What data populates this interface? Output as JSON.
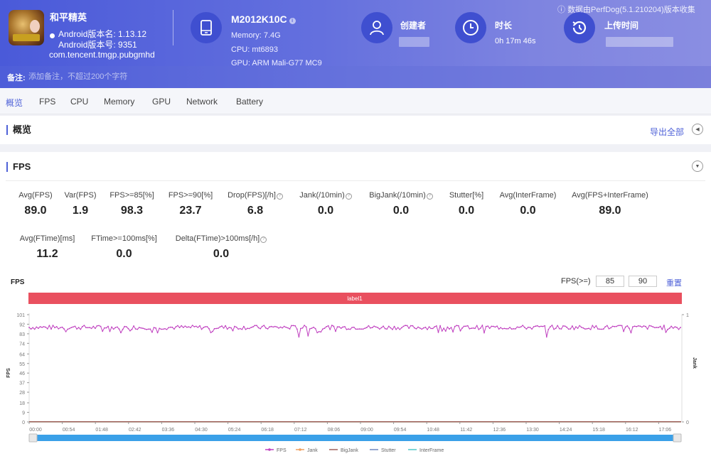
{
  "app": {
    "name": "和平精英",
    "version_name": "Android版本名: 1.13.12",
    "version_code": "Android版本号: 9351",
    "package": "com.tencent.tmgp.pubgmhd"
  },
  "device": {
    "model": "M2012K10C",
    "memory": "Memory: 7.4G",
    "cpu": "CPU: mt6893",
    "gpu": "GPU: ARM Mali-G77 MC9"
  },
  "creator": {
    "label": "创建者",
    "value_redacted": true
  },
  "duration": {
    "label": "时长",
    "value": "0h 17m 46s"
  },
  "upload_time": {
    "label": "上传时间",
    "value_redacted": true
  },
  "source_note": "数据由PerfDog(5.1.210204)版本收集",
  "remark": {
    "label": "备注:",
    "placeholder": "添加备注，不超过200个字符"
  },
  "tabs": [
    {
      "label": "概览",
      "active": true
    },
    {
      "label": "FPS",
      "active": false
    },
    {
      "label": "CPU",
      "active": false
    },
    {
      "label": "Memory",
      "active": false
    },
    {
      "label": "GPU",
      "active": false
    },
    {
      "label": "Network",
      "active": false
    },
    {
      "label": "Battery",
      "active": false
    }
  ],
  "overview": {
    "title": "概览",
    "export_label": "导出全部"
  },
  "fps_section": {
    "title": "FPS",
    "metrics_row1": [
      {
        "label": "Avg(FPS)",
        "value": "89.0",
        "help": false
      },
      {
        "label": "Var(FPS)",
        "value": "1.9",
        "help": false
      },
      {
        "label": "FPS>=85[%]",
        "value": "98.3",
        "help": false
      },
      {
        "label": "FPS>=90[%]",
        "value": "23.7",
        "help": false
      },
      {
        "label": "Drop(FPS)[/h]",
        "value": "6.8",
        "help": true
      },
      {
        "label": "Jank(/10min)",
        "value": "0.0",
        "help": true
      },
      {
        "label": "BigJank(/10min)",
        "value": "0.0",
        "help": true
      },
      {
        "label": "Stutter[%]",
        "value": "0.0",
        "help": false
      },
      {
        "label": "Avg(InterFrame)",
        "value": "0.0",
        "help": false
      },
      {
        "label": "Avg(FPS+InterFrame)",
        "value": "89.0",
        "help": false
      }
    ],
    "metrics_row2": [
      {
        "label": "Avg(FTime)[ms]",
        "value": "11.2",
        "help": false
      },
      {
        "label": "FTime>=100ms[%]",
        "value": "0.0",
        "help": false
      },
      {
        "label": "Delta(FTime)>100ms[/h]",
        "value": "0.0",
        "help": true
      }
    ],
    "threshold": {
      "label": "FPS(>=)",
      "value1": "85",
      "value2": "90",
      "reset_label": "重置"
    }
  },
  "colors": {
    "accent": "#4f62d8",
    "label_bar": "#e9505f",
    "fps_series": "#c041c0",
    "jank_series": "#f0a060",
    "bigjank_series": "#a0605a",
    "stutter_series": "#7088c0",
    "interframe_series": "#50c8c8",
    "slider": "#3aa0e8"
  },
  "chart_data": {
    "type": "line",
    "title": "FPS",
    "label_band": "label1",
    "ylabel": "FPS",
    "y2label": "Jank",
    "ylim": [
      0,
      101
    ],
    "y2lim": [
      0,
      1
    ],
    "yticks": [
      "0",
      "9",
      "18",
      "28",
      "37",
      "46",
      "55",
      "64",
      "74",
      "83",
      "92",
      "101"
    ],
    "y2ticks": [
      "0",
      "1"
    ],
    "xticks": [
      "00:00",
      "00:54",
      "01:48",
      "02:42",
      "03:36",
      "04:30",
      "05:24",
      "06:18",
      "07:12",
      "08:06",
      "09:00",
      "09:54",
      "10:48",
      "11:42",
      "12:36",
      "13:30",
      "14:24",
      "15:18",
      "16:12",
      "17:06"
    ],
    "duration_seconds": 1066,
    "series": [
      {
        "name": "FPS",
        "avg": 89.0,
        "typical_range": [
          87,
          91
        ],
        "dips": [
          {
            "t": 440,
            "v": 80
          },
          {
            "t": 455,
            "v": 81
          },
          {
            "t": 470,
            "v": 84
          },
          {
            "t": 150,
            "v": 84
          },
          {
            "t": 210,
            "v": 84
          },
          {
            "t": 745,
            "v": 84
          },
          {
            "t": 845,
            "v": 80
          },
          {
            "t": 985,
            "v": 84
          },
          {
            "t": 60,
            "v": 85
          }
        ]
      },
      {
        "name": "Jank",
        "values_constant": 0
      },
      {
        "name": "BigJank",
        "values_constant": 0
      },
      {
        "name": "Stutter",
        "values_constant": 0
      },
      {
        "name": "InterFrame",
        "values_constant": 0
      }
    ],
    "legend": [
      "FPS",
      "Jank",
      "BigJank",
      "Stutter",
      "InterFrame"
    ],
    "legend_position": "bottom-center",
    "grid": false
  }
}
